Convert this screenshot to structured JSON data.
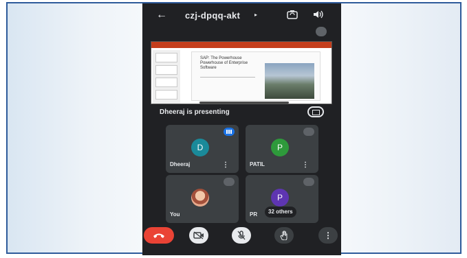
{
  "header": {
    "back_icon": "arrow-left-icon",
    "meeting_code": "czj-dpqq-akt",
    "chevron_icon": "chevron-right-icon",
    "switch_camera_icon": "switch-camera-icon",
    "speaker_icon": "speaker-icon"
  },
  "presentation": {
    "slide_title": "SAP: The Powerhouse Powerhouse of Enterprise Software",
    "presenter_label": "Dheeraj is presenting",
    "pin_icon": "fullscreen-icon"
  },
  "participants": [
    {
      "name": "Dheeraj",
      "initial": "D",
      "color": "#1a8a9a",
      "status_icon": "speaking-icon"
    },
    {
      "name": "PATIL",
      "initial": "P",
      "color": "#2e9a3b",
      "status_icon": "mic-off-icon"
    },
    {
      "name": "You",
      "initial": "",
      "status_icon": "mic-off-icon"
    },
    {
      "name": "PR",
      "initial": "P",
      "color": "#5e35b1",
      "status_icon": "mic-off-icon",
      "others": "32 others"
    }
  ],
  "controls": {
    "end_call_icon": "end-call-icon",
    "camera_icon": "camera-off-icon",
    "mic_icon": "mic-off-icon",
    "hand_icon": "raise-hand-icon",
    "more_icon": "more-vert-icon",
    "more_label": "⋮"
  },
  "colors": {
    "background": "#202124",
    "tile": "#3c4043",
    "end_call": "#ea4335",
    "frame_border": "#2d5a9a"
  }
}
